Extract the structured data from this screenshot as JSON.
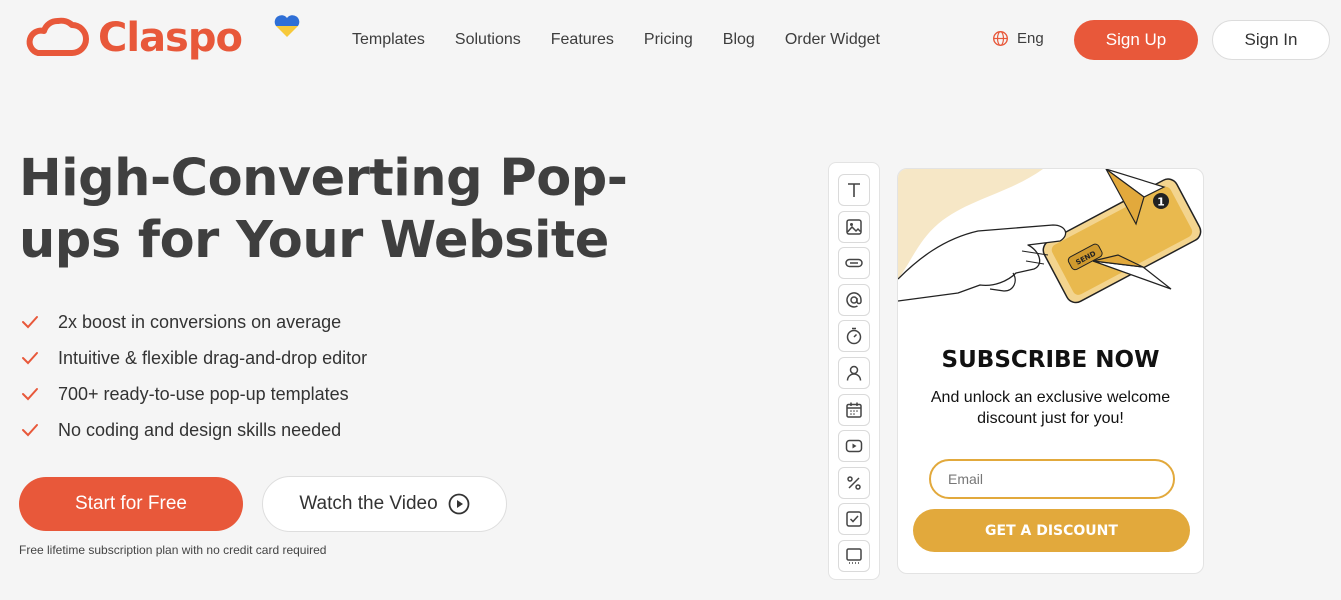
{
  "brand": {
    "name": "Claspo",
    "accent_color": "#e8583a",
    "popup_accent_color": "#e2a93c"
  },
  "nav": {
    "items": [
      "Templates",
      "Solutions",
      "Features",
      "Pricing",
      "Blog",
      "Order Widget"
    ],
    "language": "Eng",
    "signup_label": "Sign Up",
    "signin_label": "Sign In"
  },
  "hero": {
    "title": "High-Converting Pop-ups for Your Website",
    "features": [
      "2x boost in conversions on average",
      "Intuitive & flexible drag-and-drop editor",
      "700+ ready-to-use pop-up templates",
      "No coding and design skills needed"
    ],
    "start_label": "Start for Free",
    "watch_label": "Watch the Video",
    "note": "Free lifetime subscription plan with no credit card required"
  },
  "toolbar": {
    "tools": [
      "text-icon",
      "image-icon",
      "button-icon",
      "at-icon",
      "timer-icon",
      "user-icon",
      "calendar-icon",
      "video-icon",
      "percent-icon",
      "checkbox-icon",
      "widget-icon"
    ]
  },
  "popup": {
    "title": "SUBSCRIBE NOW",
    "subtitle": "And unlock an exclusive welcome discount just for you!",
    "email_placeholder": "Email",
    "cta_label": "GET A DISCOUNT",
    "illustration_label": "SEND",
    "notification_count": "1"
  }
}
